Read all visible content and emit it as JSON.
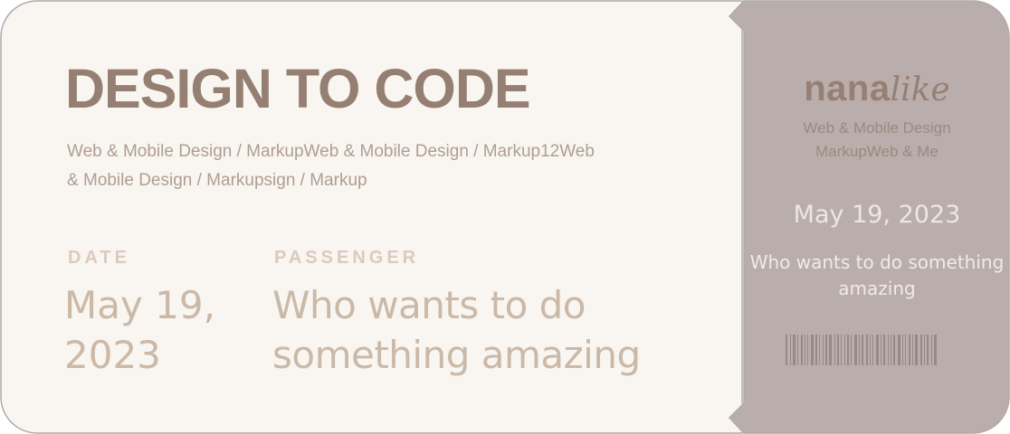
{
  "main": {
    "title": "DESIGN TO CODE",
    "subtitle": "Web & Mobile Design / MarkupWeb & Mobile Design / Markup12Web & Mobile Design / Markupsign / Markup",
    "date_label": "DATE",
    "date_value": "May 19, 2023",
    "passenger_label": "PASSENGER",
    "passenger_value": "Who wants to do something amazing"
  },
  "stub": {
    "brand_primary": "nana",
    "brand_secondary": "like",
    "subtitle_line1": "Web & Mobile Design",
    "subtitle_line2": "MarkupWeb & Me",
    "date": "May 19, 2023",
    "passenger": "Who wants to do something amazing",
    "barcode_icon": "barcode-icon"
  },
  "colors": {
    "ticket_main": "#f9f5f0",
    "ticket_stub": "#b9aeab",
    "border": "#b0aaa7",
    "title": "#957f72",
    "label": "#dccbbd",
    "value": "#cbb9a8",
    "barcode": "#978a85"
  }
}
